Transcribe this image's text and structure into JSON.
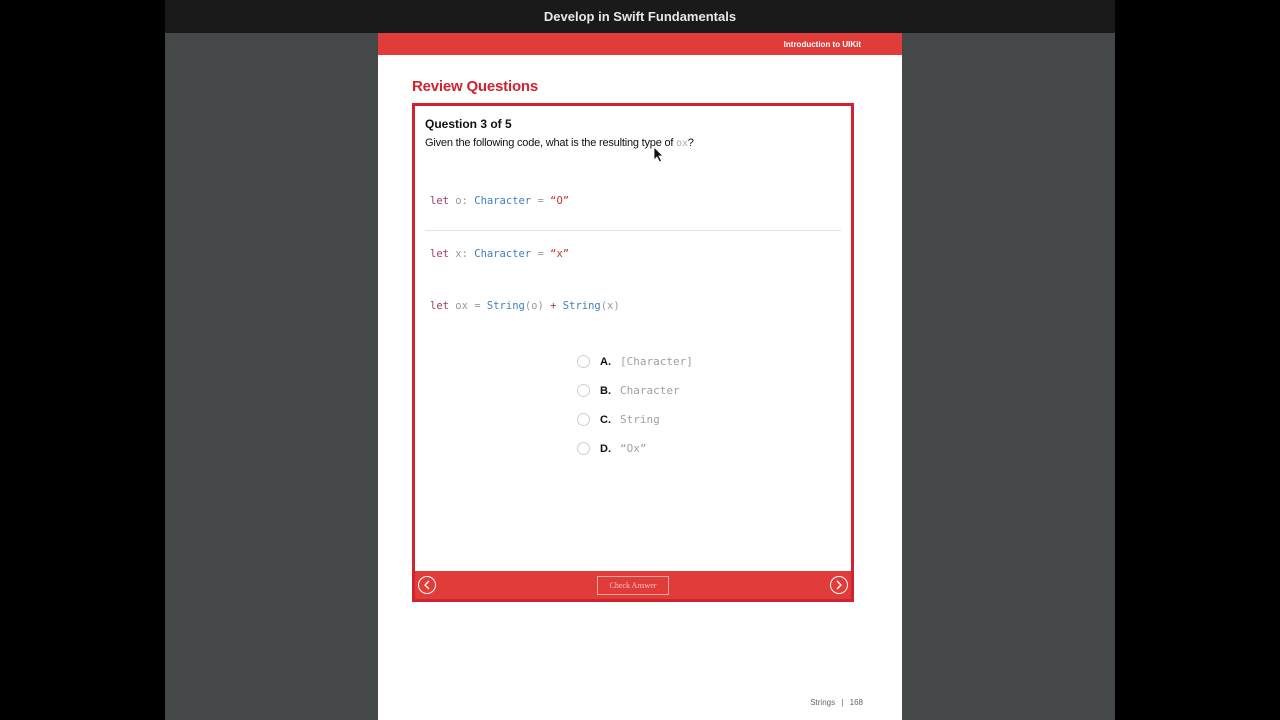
{
  "window": {
    "title": "Develop in Swift Fundamentals"
  },
  "page": {
    "chapter": "Introduction to UIKit",
    "section_title": "Review Questions",
    "footer": {
      "section": "Strings",
      "separator": "|",
      "page_number": "168"
    }
  },
  "quiz": {
    "question_header": "Question 3 of 5",
    "prompt_before": "Given the following code, what is the resulting type of ",
    "prompt_code": "ox",
    "prompt_after": "?",
    "code_lines": [
      [
        "let",
        " o: ",
        "Character",
        " = ",
        "“O”"
      ],
      [
        "let",
        " x: ",
        "Character",
        " = ",
        "“x”"
      ],
      [
        "let",
        " ox = ",
        "String",
        "(o) ",
        "+",
        " ",
        "String",
        "(x)"
      ]
    ],
    "answers": [
      {
        "letter": "A.",
        "text": "[Character]"
      },
      {
        "letter": "B.",
        "text": "Character"
      },
      {
        "letter": "C.",
        "text": "String"
      },
      {
        "letter": "D.",
        "text": "“Ox”"
      }
    ],
    "check_button": "Check Answer"
  },
  "colors": {
    "brand_red": "#e03c3a",
    "title_red": "#d0232f"
  },
  "icons": {
    "prev": "chevron-left-icon",
    "next": "chevron-right-icon"
  }
}
